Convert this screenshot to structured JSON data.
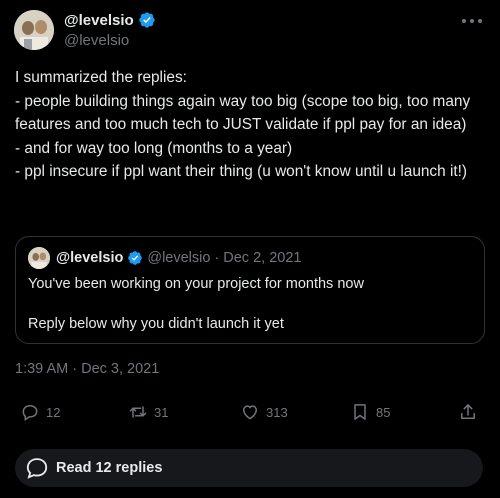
{
  "author": {
    "display_name": "@levelsio",
    "handle": "@levelsio",
    "avatar_icon": "avatar-photo",
    "verified_icon": "verified-badge-icon",
    "verified_color": "#1d9bf0"
  },
  "menu": {
    "more_icon": "more-horizontal-icon"
  },
  "tweet": {
    "lines": [
      "I summarized the replies:",
      "- people building things again way too big (scope too big, too many features and too much tech to JUST validate if ppl pay for an idea)",
      "- and for way too long (months to a year)",
      "- ppl insecure if ppl want their thing (u won't know until u launch it!)"
    ]
  },
  "quote": {
    "display_name": "@levelsio",
    "handle": "@levelsio",
    "separator": "·",
    "date": "Dec 2, 2021",
    "line1": "You've been working on your project for months now",
    "line2": "Reply below why you didn't launch it yet"
  },
  "timestamp": {
    "time": "1:39 AM",
    "separator": "·",
    "date": "Dec 3, 2021"
  },
  "actions": {
    "replies": {
      "icon": "reply-icon",
      "count": "12"
    },
    "reposts": {
      "icon": "repost-icon",
      "count": "31"
    },
    "likes": {
      "icon": "heart-icon",
      "count": "313"
    },
    "bookmarks": {
      "icon": "bookmark-icon",
      "count": "85"
    },
    "share": {
      "icon": "share-icon"
    }
  },
  "read_replies": {
    "icon": "chat-bubble-icon",
    "label": "Read 12 replies"
  },
  "colors": {
    "background": "#000000",
    "text": "#e7e9ea",
    "muted": "#71767b",
    "border": "#2f3336",
    "accent": "#1d9bf0"
  }
}
